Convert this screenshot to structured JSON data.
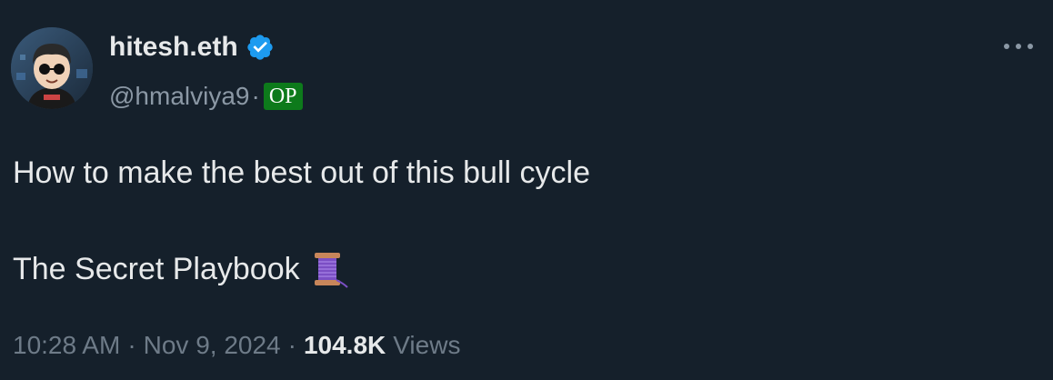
{
  "author": {
    "display_name": "hitesh.eth",
    "handle": "@hmalviya9",
    "separator": "·",
    "op_badge": "OP",
    "verified": true,
    "verified_color": "#1d9bf0"
  },
  "tweet": {
    "line1": "How to make the best out of this bull cycle",
    "line2": "The Secret Playbook",
    "line2_icon": "thread-spool-icon"
  },
  "meta": {
    "time": "10:28 AM",
    "separator": "·",
    "date": "Nov 9, 2024",
    "views_count": "104.8K",
    "views_label": "Views"
  },
  "colors": {
    "background": "#15202b",
    "primary_text": "#e7e9ea",
    "secondary_text": "#8b98a5",
    "op_badge_bg": "#0d7a1b"
  },
  "icons": {
    "more": "more-horizontal-icon",
    "verified": "verified-badge-icon"
  }
}
